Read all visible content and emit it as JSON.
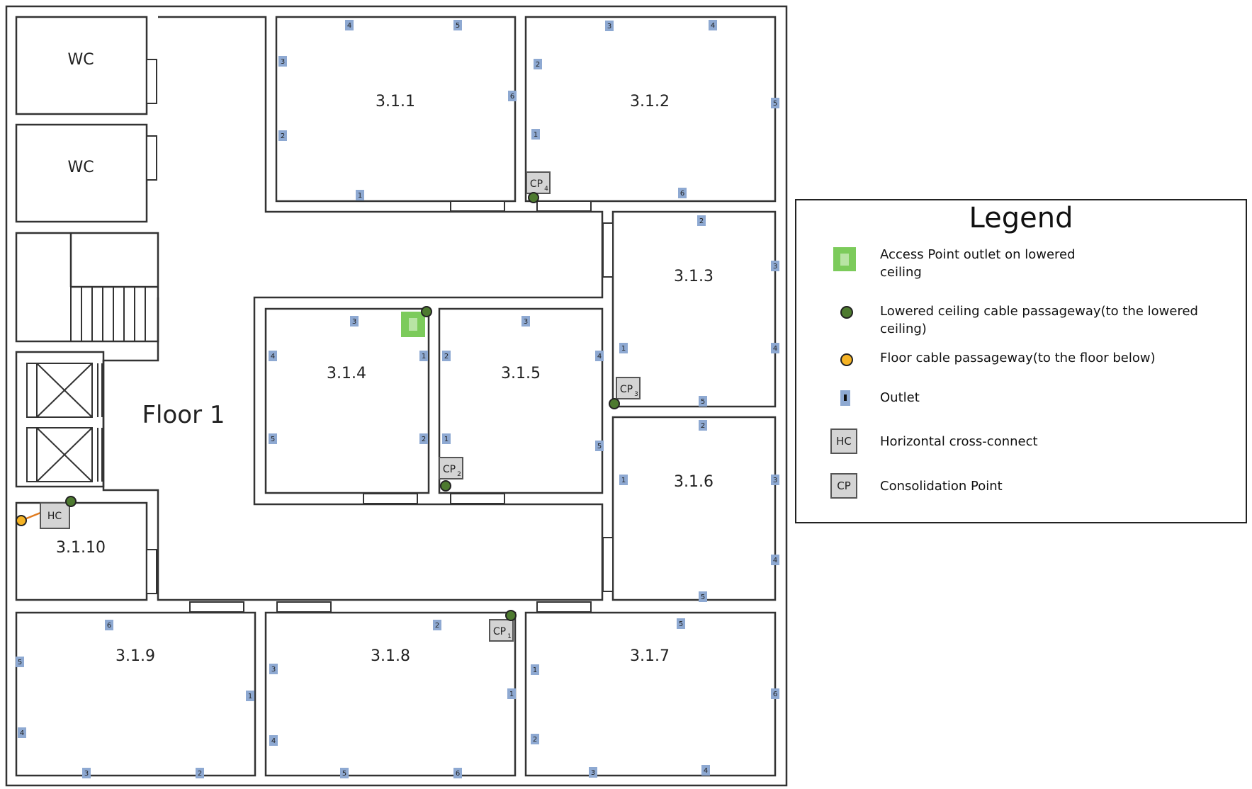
{
  "diagram": {
    "floor_label": "Floor 1",
    "rooms": [
      {
        "id": "wc_a",
        "label": "WC"
      },
      {
        "id": "wc_b",
        "label": "WC"
      },
      {
        "id": "r311",
        "label": "3.1.1"
      },
      {
        "id": "r312",
        "label": "3.1.2"
      },
      {
        "id": "r313",
        "label": "3.1.3"
      },
      {
        "id": "r314",
        "label": "3.1.4"
      },
      {
        "id": "r315",
        "label": "3.1.5"
      },
      {
        "id": "r316",
        "label": "3.1.6"
      },
      {
        "id": "r317",
        "label": "3.1.7"
      },
      {
        "id": "r318",
        "label": "3.1.8"
      },
      {
        "id": "r319",
        "label": "3.1.9"
      },
      {
        "id": "r3110",
        "label": "3.1.10"
      }
    ],
    "outlets": {
      "r311": [
        "4",
        "5",
        "3",
        "6",
        "2",
        "1"
      ],
      "r312": [
        "3",
        "4",
        "2",
        "5",
        "1",
        "6"
      ],
      "r313": [
        "2",
        "3",
        "1",
        "4",
        "5"
      ],
      "r314": [
        "3",
        "4",
        "1",
        "5",
        "2"
      ],
      "r315": [
        "3",
        "2",
        "4",
        "1",
        "5"
      ],
      "r316": [
        "2",
        "1",
        "3",
        "4",
        "5"
      ],
      "r317": [
        "5",
        "1",
        "6",
        "2",
        "3",
        "4"
      ],
      "r318": [
        "2",
        "3",
        "1",
        "4",
        "5",
        "6"
      ],
      "r319": [
        "6",
        "5",
        "1",
        "4",
        "3",
        "2"
      ]
    },
    "hc_label": "HC",
    "consolidation_points": [
      {
        "label": "CP",
        "sub": "1"
      },
      {
        "label": "CP",
        "sub": "2"
      },
      {
        "label": "CP",
        "sub": "3"
      },
      {
        "label": "CP",
        "sub": "4"
      }
    ],
    "colors": {
      "wall": "#333333",
      "outlet": "#8ea9d2",
      "access_point": "#7ccb5b",
      "ceiling_passage": "#4d7a2f",
      "floor_passage": "#f5b324",
      "box": "#d4d4d4"
    }
  },
  "legend": {
    "title": "Legend",
    "items": [
      {
        "icon": "access-point-outlet-icon",
        "label": "Access Point outlet on lowered ceiling"
      },
      {
        "icon": "ceiling-passage-icon",
        "label": "Lowered ceiling cable passageway(to the lowered ceiling)"
      },
      {
        "icon": "floor-passage-icon",
        "label": "Floor cable passageway(to the floor below)"
      },
      {
        "icon": "outlet-icon",
        "label": "Outlet"
      },
      {
        "icon": "hc-icon",
        "label": "Horizontal cross-connect",
        "symbol": "HC"
      },
      {
        "icon": "cp-icon",
        "label": "Consolidation Point",
        "symbol": "CP"
      }
    ]
  }
}
